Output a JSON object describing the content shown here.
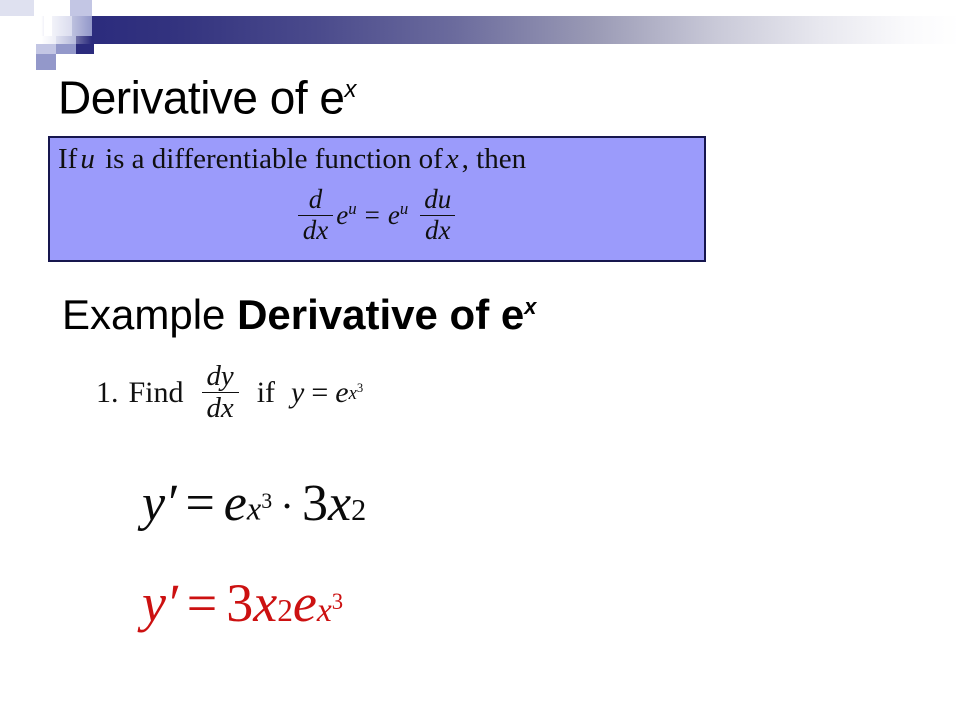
{
  "slide": {
    "title_text": "Derivative of e",
    "title_exponent": "x",
    "background_color": "#ffffff"
  },
  "decoration": {
    "name": "corner-checker-and-gradient-bar",
    "gradient_from": "#2b2b7d",
    "gradient_to": "#ffffff",
    "square_colors": [
      "#000080",
      "#2b2b7d",
      "#c3c6e4",
      "#9398ca",
      "#dfe1f0"
    ]
  },
  "rule_box": {
    "fill_color": "#9b9bfb",
    "border_color": "#16164e",
    "statement_prefix": "If",
    "statement_var": "u",
    "statement_middle": "is a differentiable function of",
    "statement_var2": "x",
    "statement_suffix": ", then",
    "formula": {
      "lhs_num": "d",
      "lhs_den": "dx",
      "lhs_fn": "e",
      "lhs_fn_exp": "u",
      "equals": "=",
      "rhs_fn": "e",
      "rhs_fn_exp": "u",
      "rhs_num": "du",
      "rhs_den": "dx"
    }
  },
  "example_heading": {
    "lead": "Example ",
    "strong": "Derivative of e",
    "exponent": "x"
  },
  "problem": {
    "number": "1.",
    "find_word": "Find",
    "frac_num": "dy",
    "frac_den": "dx",
    "if_word": "if",
    "lhs": "y",
    "equals": "=",
    "base": "e",
    "exp_base": "x",
    "exp_power": "3"
  },
  "steps": [
    {
      "id": "step-one",
      "color": "#0a0a0a",
      "lhs": "y",
      "prime": "′",
      "equals": "=",
      "base": "e",
      "exp_base": "x",
      "exp_power": "3",
      "operator": "·",
      "coefficient": "3",
      "var": "x",
      "var_power": "2"
    },
    {
      "id": "step-two",
      "color": "#cc1111",
      "lhs": "y",
      "prime": "′",
      "equals": "=",
      "coefficient": "3",
      "var": "x",
      "var_power": "2",
      "base": "e",
      "exp_base": "x",
      "exp_power": "3"
    }
  ]
}
